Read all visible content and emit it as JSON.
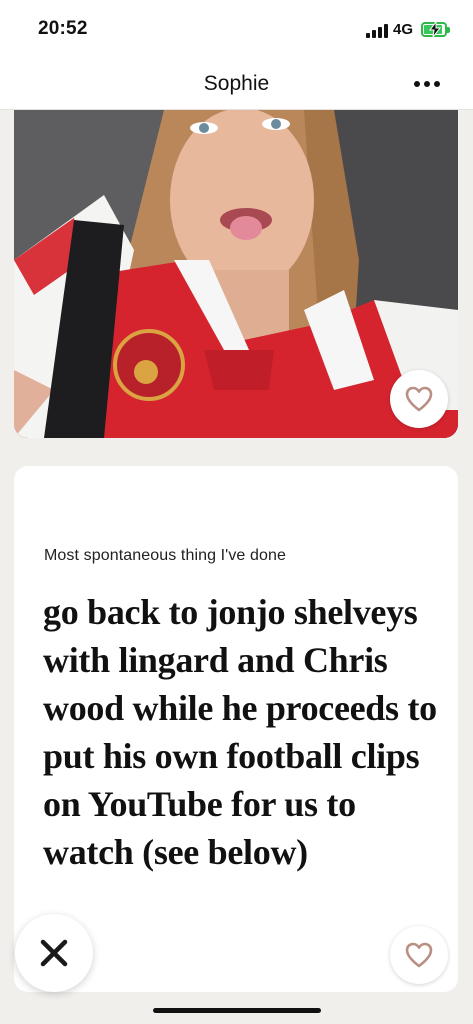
{
  "status_bar": {
    "time": "20:52",
    "network": "4G",
    "battery_charging": true
  },
  "header": {
    "title": "Sophie",
    "more_icon": "more-horizontal-icon"
  },
  "photo": {
    "description_icon": "profile-photo",
    "like_icon": "heart-outline-icon"
  },
  "prompt": {
    "label": "Most spontaneous thing I've done",
    "answer": "go back to jonjo shelveys with lingard and Chris wood while he proceeds to put his own football clips on YouTube for us to watch (see below)",
    "like_icon": "heart-outline-icon"
  },
  "actions": {
    "skip_icon": "close-x-icon"
  },
  "colors": {
    "background": "#f1efec",
    "card": "#ffffff",
    "heart": "#b98f83",
    "battery": "#38c75a"
  }
}
